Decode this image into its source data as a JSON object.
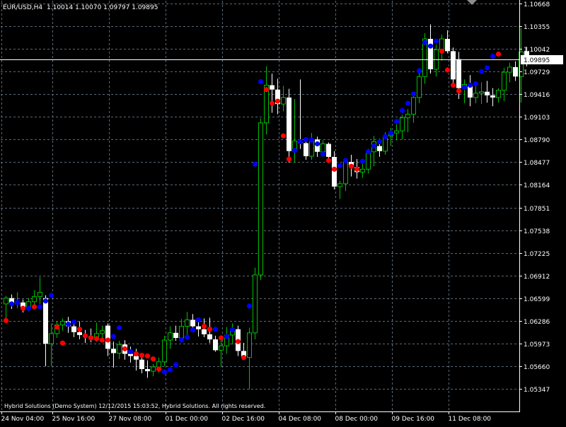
{
  "header": {
    "symbol_tf": "EUR/USD,H4",
    "quote": "1.10014 1.10070 1.09797 1.09895"
  },
  "footer": {
    "text": "Hybrid Solutions (Demo System) 12/12/2015 15:03:52, Hybrid Solutions. All rights reserved."
  },
  "colors": {
    "background": "#000000",
    "grid": "#5a6a78",
    "frame": "#ffffff",
    "bull_candle": "#00c000",
    "bear_candle": "#ffffff",
    "dot_blue": "#0000ff",
    "dot_red": "#ff0000",
    "text": "#ffffff",
    "price_label_bg": "#ffffff",
    "price_label_text": "#000000"
  },
  "chart_data": {
    "type": "candlestick",
    "symbol": "EUR/USD",
    "timeframe": "H4",
    "current_price": 1.09895,
    "ylim": [
      1.0519,
      1.1082
    ],
    "y_ticks": [
      "1.10668",
      "1.10355",
      "1.10042",
      "1.09729",
      "1.09416",
      "1.09103",
      "1.08790",
      "1.08477",
      "1.08164",
      "1.07851",
      "1.07538",
      "1.07225",
      "1.06912",
      "1.06599",
      "1.06286",
      "1.05973",
      "1.05660",
      "1.05347"
    ],
    "x_ticks": [
      {
        "label": "24 Nov 04:00",
        "index": 0
      },
      {
        "label": "25 Nov 16:00",
        "index": 9
      },
      {
        "label": "27 Nov 08:00",
        "index": 19
      },
      {
        "label": "01 Dec 00:00",
        "index": 29
      },
      {
        "label": "02 Dec 16:00",
        "index": 39
      },
      {
        "label": "04 Dec 08:00",
        "index": 49
      },
      {
        "label": "08 Dec 00:00",
        "index": 59
      },
      {
        "label": "09 Dec 16:00",
        "index": 69
      },
      {
        "label": "11 Dec 08:00",
        "index": 79
      }
    ],
    "candles": [
      {
        "o": 1.0652,
        "h": 1.0663,
        "l": 1.0629,
        "c": 1.066
      },
      {
        "o": 1.066,
        "h": 1.0665,
        "l": 1.0645,
        "c": 1.0652
      },
      {
        "o": 1.0652,
        "h": 1.0668,
        "l": 1.0646,
        "c": 1.0654
      },
      {
        "o": 1.0654,
        "h": 1.0658,
        "l": 1.064,
        "c": 1.0646
      },
      {
        "o": 1.0646,
        "h": 1.066,
        "l": 1.0642,
        "c": 1.0655
      },
      {
        "o": 1.0655,
        "h": 1.0671,
        "l": 1.0648,
        "c": 1.0662
      },
      {
        "o": 1.0662,
        "h": 1.0689,
        "l": 1.0652,
        "c": 1.0668
      },
      {
        "o": 1.066,
        "h": 1.0664,
        "l": 1.0566,
        "c": 1.0597
      },
      {
        "o": 1.0597,
        "h": 1.0625,
        "l": 1.0566,
        "c": 1.0611
      },
      {
        "o": 1.0611,
        "h": 1.0628,
        "l": 1.0605,
        "c": 1.0623
      },
      {
        "o": 1.0623,
        "h": 1.0632,
        "l": 1.0615,
        "c": 1.0628
      },
      {
        "o": 1.0628,
        "h": 1.0634,
        "l": 1.0612,
        "c": 1.0621
      },
      {
        "o": 1.0621,
        "h": 1.0626,
        "l": 1.0606,
        "c": 1.0613
      },
      {
        "o": 1.0613,
        "h": 1.0628,
        "l": 1.0603,
        "c": 1.0609
      },
      {
        "o": 1.0609,
        "h": 1.0616,
        "l": 1.0598,
        "c": 1.0607
      },
      {
        "o": 1.0607,
        "h": 1.0618,
        "l": 1.0599,
        "c": 1.0605
      },
      {
        "o": 1.0605,
        "h": 1.0626,
        "l": 1.06,
        "c": 1.0611
      },
      {
        "o": 1.0611,
        "h": 1.0622,
        "l": 1.0605,
        "c": 1.0615
      },
      {
        "o": 1.0622,
        "h": 1.0625,
        "l": 1.058,
        "c": 1.059
      },
      {
        "o": 1.059,
        "h": 1.06,
        "l": 1.0564,
        "c": 1.0584
      },
      {
        "o": 1.0584,
        "h": 1.0601,
        "l": 1.0576,
        "c": 1.0596
      },
      {
        "o": 1.0596,
        "h": 1.0602,
        "l": 1.0575,
        "c": 1.0583
      },
      {
        "o": 1.0583,
        "h": 1.0593,
        "l": 1.0571,
        "c": 1.058
      },
      {
        "o": 1.058,
        "h": 1.059,
        "l": 1.056,
        "c": 1.0575
      },
      {
        "o": 1.0575,
        "h": 1.0584,
        "l": 1.0556,
        "c": 1.0562
      },
      {
        "o": 1.0562,
        "h": 1.0574,
        "l": 1.055,
        "c": 1.0559
      },
      {
        "o": 1.0559,
        "h": 1.0569,
        "l": 1.0552,
        "c": 1.0565
      },
      {
        "o": 1.0565,
        "h": 1.0578,
        "l": 1.0557,
        "c": 1.0572
      },
      {
        "o": 1.0572,
        "h": 1.0608,
        "l": 1.0566,
        "c": 1.0602
      },
      {
        "o": 1.0602,
        "h": 1.0621,
        "l": 1.059,
        "c": 1.0612
      },
      {
        "o": 1.0612,
        "h": 1.0622,
        "l": 1.0601,
        "c": 1.0605
      },
      {
        "o": 1.0605,
        "h": 1.0631,
        "l": 1.06,
        "c": 1.0621
      },
      {
        "o": 1.0621,
        "h": 1.0641,
        "l": 1.0606,
        "c": 1.063
      },
      {
        "o": 1.063,
        "h": 1.0638,
        "l": 1.0616,
        "c": 1.0621
      },
      {
        "o": 1.0621,
        "h": 1.063,
        "l": 1.0607,
        "c": 1.0617
      },
      {
        "o": 1.0617,
        "h": 1.0632,
        "l": 1.0606,
        "c": 1.061
      },
      {
        "o": 1.061,
        "h": 1.0633,
        "l": 1.0598,
        "c": 1.0603
      },
      {
        "o": 1.0603,
        "h": 1.0608,
        "l": 1.0586,
        "c": 1.0588
      },
      {
        "o": 1.0588,
        "h": 1.0608,
        "l": 1.0565,
        "c": 1.0594
      },
      {
        "o": 1.0594,
        "h": 1.062,
        "l": 1.0583,
        "c": 1.0609
      },
      {
        "o": 1.0609,
        "h": 1.0625,
        "l": 1.0596,
        "c": 1.0617
      },
      {
        "o": 1.0617,
        "h": 1.0622,
        "l": 1.058,
        "c": 1.0587
      },
      {
        "o": 1.0587,
        "h": 1.0598,
        "l": 1.0576,
        "c": 1.0578
      },
      {
        "o": 1.0578,
        "h": 1.0619,
        "l": 1.0534,
        "c": 1.0612
      },
      {
        "o": 1.0612,
        "h": 1.0702,
        "l": 1.0603,
        "c": 1.0692
      },
      {
        "o": 1.0692,
        "h": 1.0908,
        "l": 1.0685,
        "c": 1.0902
      },
      {
        "o": 1.0902,
        "h": 1.098,
        "l": 1.0886,
        "c": 1.0954
      },
      {
        "o": 1.0954,
        "h": 1.097,
        "l": 1.0916,
        "c": 1.0948
      },
      {
        "o": 1.0948,
        "h": 1.0963,
        "l": 1.0914,
        "c": 1.0928
      },
      {
        "o": 1.0928,
        "h": 1.0953,
        "l": 1.0918,
        "c": 1.0937
      },
      {
        "o": 1.0937,
        "h": 1.0949,
        "l": 1.0847,
        "c": 1.0863
      },
      {
        "o": 1.0863,
        "h": 1.0935,
        "l": 1.0847,
        "c": 1.0877
      },
      {
        "o": 1.0877,
        "h": 1.0962,
        "l": 1.0866,
        "c": 1.0874
      },
      {
        "o": 1.0874,
        "h": 1.0882,
        "l": 1.0851,
        "c": 1.0856
      },
      {
        "o": 1.0856,
        "h": 1.0888,
        "l": 1.0851,
        "c": 1.0879
      },
      {
        "o": 1.0879,
        "h": 1.0883,
        "l": 1.0855,
        "c": 1.0862
      },
      {
        "o": 1.0862,
        "h": 1.0878,
        "l": 1.0855,
        "c": 1.0873
      },
      {
        "o": 1.0873,
        "h": 1.0875,
        "l": 1.085,
        "c": 1.0855
      },
      {
        "o": 1.0855,
        "h": 1.0863,
        "l": 1.081,
        "c": 1.0814
      },
      {
        "o": 1.0814,
        "h": 1.0822,
        "l": 1.0797,
        "c": 1.0818
      },
      {
        "o": 1.0818,
        "h": 1.0852,
        "l": 1.0808,
        "c": 1.0848
      },
      {
        "o": 1.0848,
        "h": 1.0858,
        "l": 1.0828,
        "c": 1.0841
      },
      {
        "o": 1.0841,
        "h": 1.0852,
        "l": 1.0825,
        "c": 1.0834
      },
      {
        "o": 1.0834,
        "h": 1.0849,
        "l": 1.0826,
        "c": 1.0838
      },
      {
        "o": 1.0838,
        "h": 1.0866,
        "l": 1.0832,
        "c": 1.0862
      },
      {
        "o": 1.0862,
        "h": 1.0884,
        "l": 1.0842,
        "c": 1.0876
      },
      {
        "o": 1.087,
        "h": 1.088,
        "l": 1.0855,
        "c": 1.0863
      },
      {
        "o": 1.0863,
        "h": 1.0889,
        "l": 1.0858,
        "c": 1.0884
      },
      {
        "o": 1.0884,
        "h": 1.0895,
        "l": 1.087,
        "c": 1.0888
      },
      {
        "o": 1.0888,
        "h": 1.09,
        "l": 1.0878,
        "c": 1.0891
      },
      {
        "o": 1.0891,
        "h": 1.0913,
        "l": 1.0879,
        "c": 1.0909
      },
      {
        "o": 1.0909,
        "h": 1.0921,
        "l": 1.0889,
        "c": 1.0914
      },
      {
        "o": 1.0914,
        "h": 1.0944,
        "l": 1.0902,
        "c": 1.0937
      },
      {
        "o": 1.0937,
        "h": 1.0972,
        "l": 1.0929,
        "c": 1.0966
      },
      {
        "o": 1.0966,
        "h": 1.1026,
        "l": 1.0956,
        "c": 1.1018
      },
      {
        "o": 1.1018,
        "h": 1.1038,
        "l": 1.097,
        "c": 1.0976
      },
      {
        "o": 1.0976,
        "h": 1.101,
        "l": 1.0966,
        "c": 1.1003
      },
      {
        "o": 1.1003,
        "h": 1.1024,
        "l": 1.0988,
        "c": 1.1018
      },
      {
        "o": 1.1018,
        "h": 1.103,
        "l": 1.0998,
        "c": 1.1001
      },
      {
        "o": 1.1001,
        "h": 1.1006,
        "l": 1.0953,
        "c": 1.0962
      },
      {
        "o": 1.099,
        "h": 1.1,
        "l": 1.0935,
        "c": 1.095
      },
      {
        "o": 1.095,
        "h": 1.0962,
        "l": 1.0929,
        "c": 1.0955
      },
      {
        "o": 1.0955,
        "h": 1.0968,
        "l": 1.0925,
        "c": 1.0937
      },
      {
        "o": 1.0937,
        "h": 1.0954,
        "l": 1.0929,
        "c": 1.0943
      },
      {
        "o": 1.0943,
        "h": 1.0958,
        "l": 1.0928,
        "c": 1.0945
      },
      {
        "o": 1.0945,
        "h": 1.096,
        "l": 1.093,
        "c": 1.094
      },
      {
        "o": 1.094,
        "h": 1.095,
        "l": 1.0925,
        "c": 1.0937
      },
      {
        "o": 1.0937,
        "h": 1.095,
        "l": 1.093,
        "c": 1.0947
      },
      {
        "o": 1.0947,
        "h": 1.0978,
        "l": 1.0932,
        "c": 1.0972
      },
      {
        "o": 1.0972,
        "h": 1.0985,
        "l": 1.0958,
        "c": 1.0979
      },
      {
        "o": 1.0979,
        "h": 1.0987,
        "l": 1.096,
        "c": 1.0966
      },
      {
        "o": 1.0966,
        "h": 1.1033,
        "l": 1.093,
        "c": 1.1
      },
      {
        "o": 1.1001,
        "h": 1.1007,
        "l": 1.098,
        "c": 1.099
      }
    ],
    "dots": [
      {
        "i": 0,
        "p": 1.0629,
        "c": "red"
      },
      {
        "i": 1,
        "p": 1.0652,
        "c": "blue"
      },
      {
        "i": 2,
        "p": 1.0654,
        "c": "blue"
      },
      {
        "i": 3,
        "p": 1.0646,
        "c": "red"
      },
      {
        "i": 4,
        "p": 1.0646,
        "c": "blue"
      },
      {
        "i": 5,
        "p": 1.0648,
        "c": "red"
      },
      {
        "i": 6,
        "p": 1.0648,
        "c": "blue"
      },
      {
        "i": 7,
        "p": 1.0656,
        "c": "blue"
      },
      {
        "i": 8,
        "p": 1.0664,
        "c": "blue"
      },
      {
        "i": 9,
        "p": 1.062,
        "c": "red"
      },
      {
        "i": 10,
        "p": 1.0598,
        "c": "red"
      },
      {
        "i": 11,
        "p": 1.0624,
        "c": "blue"
      },
      {
        "i": 12,
        "p": 1.0627,
        "c": "blue"
      },
      {
        "i": 13,
        "p": 1.0617,
        "c": "red"
      },
      {
        "i": 14,
        "p": 1.0608,
        "c": "red"
      },
      {
        "i": 15,
        "p": 1.0605,
        "c": "red"
      },
      {
        "i": 16,
        "p": 1.0604,
        "c": "red"
      },
      {
        "i": 17,
        "p": 1.0602,
        "c": "red"
      },
      {
        "i": 18,
        "p": 1.0602,
        "c": "red"
      },
      {
        "i": 19,
        "p": 1.0607,
        "c": "blue"
      },
      {
        "i": 20,
        "p": 1.0619,
        "c": "blue"
      },
      {
        "i": 21,
        "p": 1.059,
        "c": "red"
      },
      {
        "i": 22,
        "p": 1.0586,
        "c": "blue"
      },
      {
        "i": 23,
        "p": 1.0583,
        "c": "red"
      },
      {
        "i": 24,
        "p": 1.0581,
        "c": "red"
      },
      {
        "i": 25,
        "p": 1.058,
        "c": "red"
      },
      {
        "i": 26,
        "p": 1.0576,
        "c": "red"
      },
      {
        "i": 27,
        "p": 1.0562,
        "c": "red"
      },
      {
        "i": 28,
        "p": 1.0558,
        "c": "blue"
      },
      {
        "i": 29,
        "p": 1.0561,
        "c": "blue"
      },
      {
        "i": 30,
        "p": 1.0568,
        "c": "blue"
      },
      {
        "i": 31,
        "p": 1.0602,
        "c": "blue"
      },
      {
        "i": 32,
        "p": 1.0606,
        "c": "blue"
      },
      {
        "i": 33,
        "p": 1.0616,
        "c": "blue"
      },
      {
        "i": 34,
        "p": 1.063,
        "c": "blue"
      },
      {
        "i": 35,
        "p": 1.0621,
        "c": "red"
      },
      {
        "i": 36,
        "p": 1.0617,
        "c": "red"
      },
      {
        "i": 37,
        "p": 1.0617,
        "c": "blue"
      },
      {
        "i": 38,
        "p": 1.0605,
        "c": "red"
      },
      {
        "i": 39,
        "p": 1.0607,
        "c": "blue"
      },
      {
        "i": 40,
        "p": 1.0616,
        "c": "blue"
      },
      {
        "i": 41,
        "p": 1.06,
        "c": "red"
      },
      {
        "i": 42,
        "p": 1.0578,
        "c": "red"
      },
      {
        "i": 43,
        "p": 1.0649,
        "c": "blue"
      },
      {
        "i": 44,
        "p": 1.0845,
        "c": "blue"
      },
      {
        "i": 45,
        "p": 1.0959,
        "c": "blue"
      },
      {
        "i": 46,
        "p": 1.0948,
        "c": "red"
      },
      {
        "i": 47,
        "p": 1.0929,
        "c": "red"
      },
      {
        "i": 48,
        "p": 1.0932,
        "c": "red"
      },
      {
        "i": 49,
        "p": 1.0884,
        "c": "red"
      },
      {
        "i": 50,
        "p": 1.0852,
        "c": "red"
      },
      {
        "i": 51,
        "p": 1.0864,
        "c": "blue"
      },
      {
        "i": 52,
        "p": 1.0876,
        "c": "blue"
      },
      {
        "i": 53,
        "p": 1.0879,
        "c": "blue"
      },
      {
        "i": 54,
        "p": 1.0878,
        "c": "blue"
      },
      {
        "i": 55,
        "p": 1.0873,
        "c": "blue"
      },
      {
        "i": 56,
        "p": 1.0859,
        "c": "blue"
      },
      {
        "i": 57,
        "p": 1.085,
        "c": "red"
      },
      {
        "i": 58,
        "p": 1.0838,
        "c": "red"
      },
      {
        "i": 59,
        "p": 1.0843,
        "c": "blue"
      },
      {
        "i": 60,
        "p": 1.085,
        "c": "blue"
      },
      {
        "i": 61,
        "p": 1.0842,
        "c": "red"
      },
      {
        "i": 62,
        "p": 1.0838,
        "c": "red"
      },
      {
        "i": 63,
        "p": 1.0849,
        "c": "blue"
      },
      {
        "i": 64,
        "p": 1.0862,
        "c": "blue"
      },
      {
        "i": 65,
        "p": 1.087,
        "c": "blue"
      },
      {
        "i": 66,
        "p": 1.0876,
        "c": "blue"
      },
      {
        "i": 67,
        "p": 1.0883,
        "c": "blue"
      },
      {
        "i": 68,
        "p": 1.0888,
        "c": "blue"
      },
      {
        "i": 69,
        "p": 1.0904,
        "c": "blue"
      },
      {
        "i": 70,
        "p": 1.0919,
        "c": "blue"
      },
      {
        "i": 71,
        "p": 1.0929,
        "c": "blue"
      },
      {
        "i": 72,
        "p": 1.0942,
        "c": "blue"
      },
      {
        "i": 73,
        "p": 1.0974,
        "c": "blue"
      },
      {
        "i": 74,
        "p": 1.1013,
        "c": "blue"
      },
      {
        "i": 75,
        "p": 1.1008,
        "c": "blue"
      },
      {
        "i": 76,
        "p": 1.1015,
        "c": "blue"
      },
      {
        "i": 77,
        "p": 1.1001,
        "c": "red"
      },
      {
        "i": 78,
        "p": 1.0975,
        "c": "red"
      },
      {
        "i": 79,
        "p": 1.0954,
        "c": "red"
      },
      {
        "i": 80,
        "p": 1.0946,
        "c": "red"
      },
      {
        "i": 81,
        "p": 1.0951,
        "c": "blue"
      },
      {
        "i": 82,
        "p": 1.0954,
        "c": "blue"
      },
      {
        "i": 83,
        "p": 1.0956,
        "c": "blue"
      },
      {
        "i": 84,
        "p": 1.0973,
        "c": "blue"
      },
      {
        "i": 85,
        "p": 1.0978,
        "c": "blue"
      },
      {
        "i": 86,
        "p": 1.0994,
        "c": "blue"
      },
      {
        "i": 87,
        "p": 1.0997,
        "c": "red"
      }
    ]
  }
}
